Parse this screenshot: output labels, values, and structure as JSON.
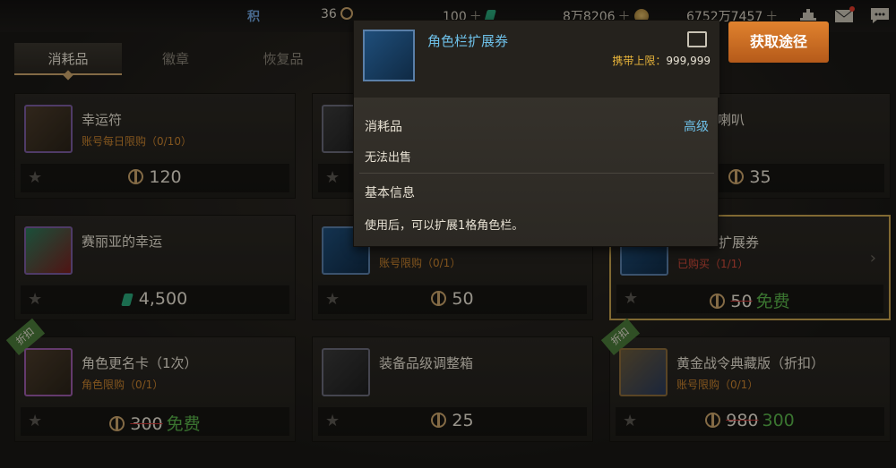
{
  "topbar": {
    "points_label": "积",
    "coin_value": "36",
    "coin_plus_value": "100",
    "gem_value": "8万8206",
    "gold_value": "6752万7457"
  },
  "tabs": [
    "消耗品",
    "徽章",
    "恢复品"
  ],
  "cards": [
    {
      "name": "幸运符",
      "limit": "账号每日限购（0/10）",
      "price": "120",
      "old": "",
      "free": ""
    },
    {
      "name": "",
      "limit": "",
      "price": "",
      "old": "",
      "free": ""
    },
    {
      "name": "喇叭",
      "limit": "",
      "price": "35",
      "old": "",
      "free": ""
    },
    {
      "name": "赛丽亚的幸运",
      "limit": "",
      "price": "4,500",
      "old": "",
      "free": ""
    },
    {
      "name": "",
      "limit": "账号限购（0/1）",
      "price": "50",
      "old": "",
      "free": ""
    },
    {
      "name": "扩展券",
      "limit": "已购买（1/1）",
      "price": "",
      "old": "50",
      "free": "免费"
    },
    {
      "name": "角色更名卡（1次）",
      "limit": "角色限购（0/1）",
      "price": "",
      "old": "300",
      "free": "免费",
      "ribbon": "折扣"
    },
    {
      "name": "装备品级调整箱",
      "limit": "",
      "price": "25",
      "old": "",
      "free": ""
    },
    {
      "name": "黄金战令典藏版（折扣）",
      "limit": "账号限购（0/1）",
      "price": "",
      "old": "980",
      "free": "300",
      "ribbon": "折扣"
    }
  ],
  "tooltip": {
    "title": "角色栏扩展券",
    "carry_label": "携带上限：",
    "carry_value": "999,999",
    "category": "消耗品",
    "grade": "高级",
    "no_sell": "无法出售",
    "basic_info": "基本信息",
    "description": "使用后，可以扩展1格角色栏。"
  },
  "get_button": "获取途径"
}
